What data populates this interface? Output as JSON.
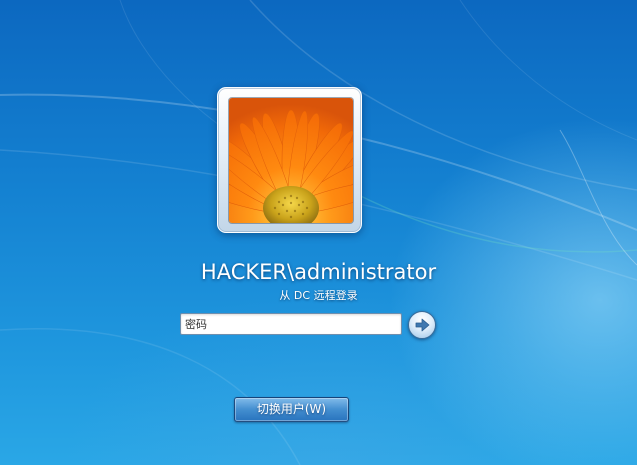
{
  "login": {
    "username": "HACKER\\administrator",
    "status_text": "从 DC 远程登录",
    "password_placeholder": "密码",
    "switch_user_label": "切换用户(W)"
  },
  "icons": {
    "submit": "arrow-right-icon",
    "avatar": "orange-flower-picture"
  },
  "colors": {
    "background_top": "#0c68c0",
    "background_bottom": "#2aa7e6",
    "text": "#ffffff"
  }
}
